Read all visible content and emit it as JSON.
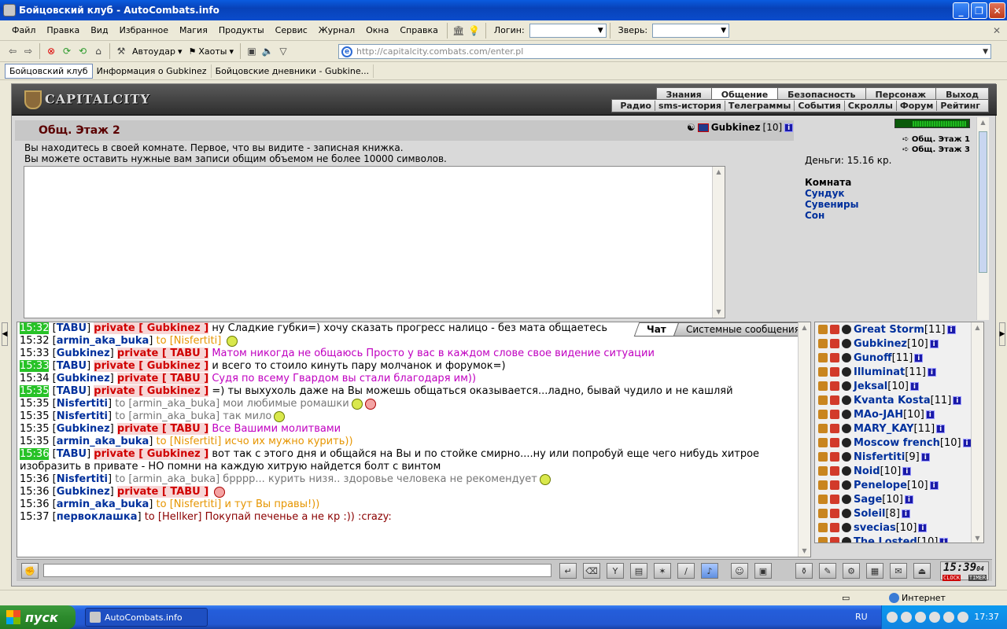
{
  "window": {
    "title": "Бойцовский клуб - AutoCombats.info"
  },
  "menu": {
    "items": [
      "Файл",
      "Правка",
      "Вид",
      "Избранное",
      "Магия",
      "Продукты",
      "Сервис",
      "Журнал",
      "Окна",
      "Справка"
    ],
    "login_label": "Логин:",
    "beast_label": "Зверь:"
  },
  "toolbar": {
    "autoudar": "Автоудар",
    "haoty": "Хаоты",
    "address": "http://capitalcity.combats.com/enter.pl"
  },
  "tabs": [
    "Бойцовский клуб",
    "Информация о Gubkinez",
    "Бойцовские дневники - Gubkine..."
  ],
  "site": {
    "logo": "CAPITALCITY",
    "nav_top": [
      "Знания",
      "Общение",
      "Безопасность",
      "Персонаж",
      "Выход"
    ],
    "nav_bottom": [
      "Радио",
      "sms-история",
      "Телеграммы",
      "События",
      "Скроллы",
      "Форум",
      "Рейтинг"
    ]
  },
  "room": {
    "title": "Общ. Этаж 2",
    "user": "Gubkinez",
    "user_level": "[10]",
    "desc1": "Вы находитесь в своей комнате. Первое, что вы видите - записная книжка.",
    "desc2": "Вы можете оставить нужные вам записи общим объемом не более 10000 символов."
  },
  "right": {
    "floor1": "Общ. Этаж 1",
    "floor3": "Общ. Этаж 3",
    "money": "Деньги: 15.16 кр.",
    "room_head": "Комната",
    "links": [
      "Сундук",
      "Сувениры",
      "Сон"
    ]
  },
  "chat": {
    "tab_chat": "Чат",
    "tab_sys": "Системные сообщения",
    "lines": [
      {
        "t": "15:32",
        "hl": true,
        "nick": "TABU",
        "kind": "private",
        "to": "Gubkinez",
        "text": "ну Сладкие губки=) хочу сказать прогресс налицо - без мата общаетесь",
        "cls": "msg-t"
      },
      {
        "t": "15:32",
        "hl": false,
        "nick": "armin_aka_buka",
        "kind": "to",
        "to": "Nisfertiti",
        "text": "",
        "cls": "msg-o"
      },
      {
        "t": "15:33",
        "hl": false,
        "nick": "Gubkinez",
        "kind": "private",
        "to": "TABU",
        "text": "Матом никогда не общаюсь Просто у вас в каждом слове свое видение ситуации",
        "cls": "msg-m"
      },
      {
        "t": "15:33",
        "hl": true,
        "nick": "TABU",
        "kind": "private",
        "to": "Gubkinez",
        "text": "и всего то стоило кинуть пару молчанок и форумок=)",
        "cls": "msg-t"
      },
      {
        "t": "15:34",
        "hl": false,
        "nick": "Gubkinez",
        "kind": "private",
        "to": "TABU",
        "text": "Судя по всему Гвардом вы стали благодаря им))",
        "cls": "msg-m"
      },
      {
        "t": "15:35",
        "hl": true,
        "nick": "TABU",
        "kind": "private",
        "to": "Gubkinez",
        "text": "=) ты выхухоль даже на Вы можешь общаться оказывается...ладно, бывай чудило и не кашляй",
        "cls": "msg-t"
      },
      {
        "t": "15:35",
        "hl": false,
        "nick": "Nisfertiti",
        "kind": "to",
        "to": "armin_aka_buka",
        "text": "мои любимые ромашки",
        "cls": "msg-g"
      },
      {
        "t": "15:35",
        "hl": false,
        "nick": "Nisfertiti",
        "kind": "to",
        "to": "armin_aka_buka",
        "text": "так мило",
        "cls": "msg-g"
      },
      {
        "t": "15:35",
        "hl": false,
        "nick": "Gubkinez",
        "kind": "private",
        "to": "TABU",
        "text": "Все Вашими молитвами",
        "cls": "msg-m"
      },
      {
        "t": "15:35",
        "hl": false,
        "nick": "armin_aka_buka",
        "kind": "to",
        "to": "Nisfertiti",
        "text": "исчо их мужно курить))",
        "cls": "msg-o"
      },
      {
        "t": "15:36",
        "hl": true,
        "nick": "TABU",
        "kind": "private",
        "to": "Gubkinez",
        "text": "вот так с этого дня и общайся на Вы и по стойке смирно....ну или попробуй еще чего нибудь хитрое",
        "cls": "msg-t"
      },
      {
        "t": "",
        "hl": false,
        "nick": "",
        "kind": "cont",
        "to": "",
        "text": "изобразить в привате - НО помни на каждую хитрую найдется болт с винтом",
        "cls": "msg-t"
      },
      {
        "t": "15:36",
        "hl": false,
        "nick": "Nisfertiti",
        "kind": "to",
        "to": "armin_aka_buka",
        "text": "брррр... курить низя.. здоровье человека не рекомендует",
        "cls": "msg-g"
      },
      {
        "t": "15:36",
        "hl": false,
        "nick": "Gubkinez",
        "kind": "private",
        "to": "TABU",
        "text": "",
        "cls": "msg-m"
      },
      {
        "t": "15:36",
        "hl": false,
        "nick": "armin_aka_buka",
        "kind": "to",
        "to": "Nisfertiti",
        "text": "и тут Вы правы!))",
        "cls": "msg-o"
      },
      {
        "t": "15:37",
        "hl": false,
        "nick": "первоклашка",
        "kind": "to",
        "to": "Hellker",
        "text": "Покупай печенье а не кр :)) :crazy:",
        "cls": "msg-r"
      }
    ]
  },
  "users": [
    {
      "name": "Great Storm",
      "lvl": "[11]"
    },
    {
      "name": "Gubkinez",
      "lvl": "[10]"
    },
    {
      "name": "Gunoff",
      "lvl": "[11]"
    },
    {
      "name": "Illuminat",
      "lvl": "[11]"
    },
    {
      "name": "Jeksal",
      "lvl": "[10]"
    },
    {
      "name": "Kvanta Kosta",
      "lvl": "[11]"
    },
    {
      "name": "MAo-JAH",
      "lvl": "[10]"
    },
    {
      "name": "MARY_KAY",
      "lvl": "[11]"
    },
    {
      "name": "Moscow french",
      "lvl": "[10]"
    },
    {
      "name": "Nisfertiti",
      "lvl": "[9]"
    },
    {
      "name": "Noid",
      "lvl": "[10]"
    },
    {
      "name": "Penelope",
      "lvl": "[10]"
    },
    {
      "name": "Sage",
      "lvl": "[10]"
    },
    {
      "name": "Soleil",
      "lvl": "[8]"
    },
    {
      "name": "svecias",
      "lvl": "[10]"
    },
    {
      "name": "The Losted",
      "lvl": "[10]"
    }
  ],
  "clock": {
    "time": "15:39",
    "sec": "04",
    "clock_lbl": "CLOCK",
    "timer_lbl": "TIMER"
  },
  "status": {
    "zone": "Интернет"
  },
  "taskbar": {
    "start": "пуск",
    "task": "AutoCombats.info",
    "lang": "RU",
    "time": "17:37"
  }
}
